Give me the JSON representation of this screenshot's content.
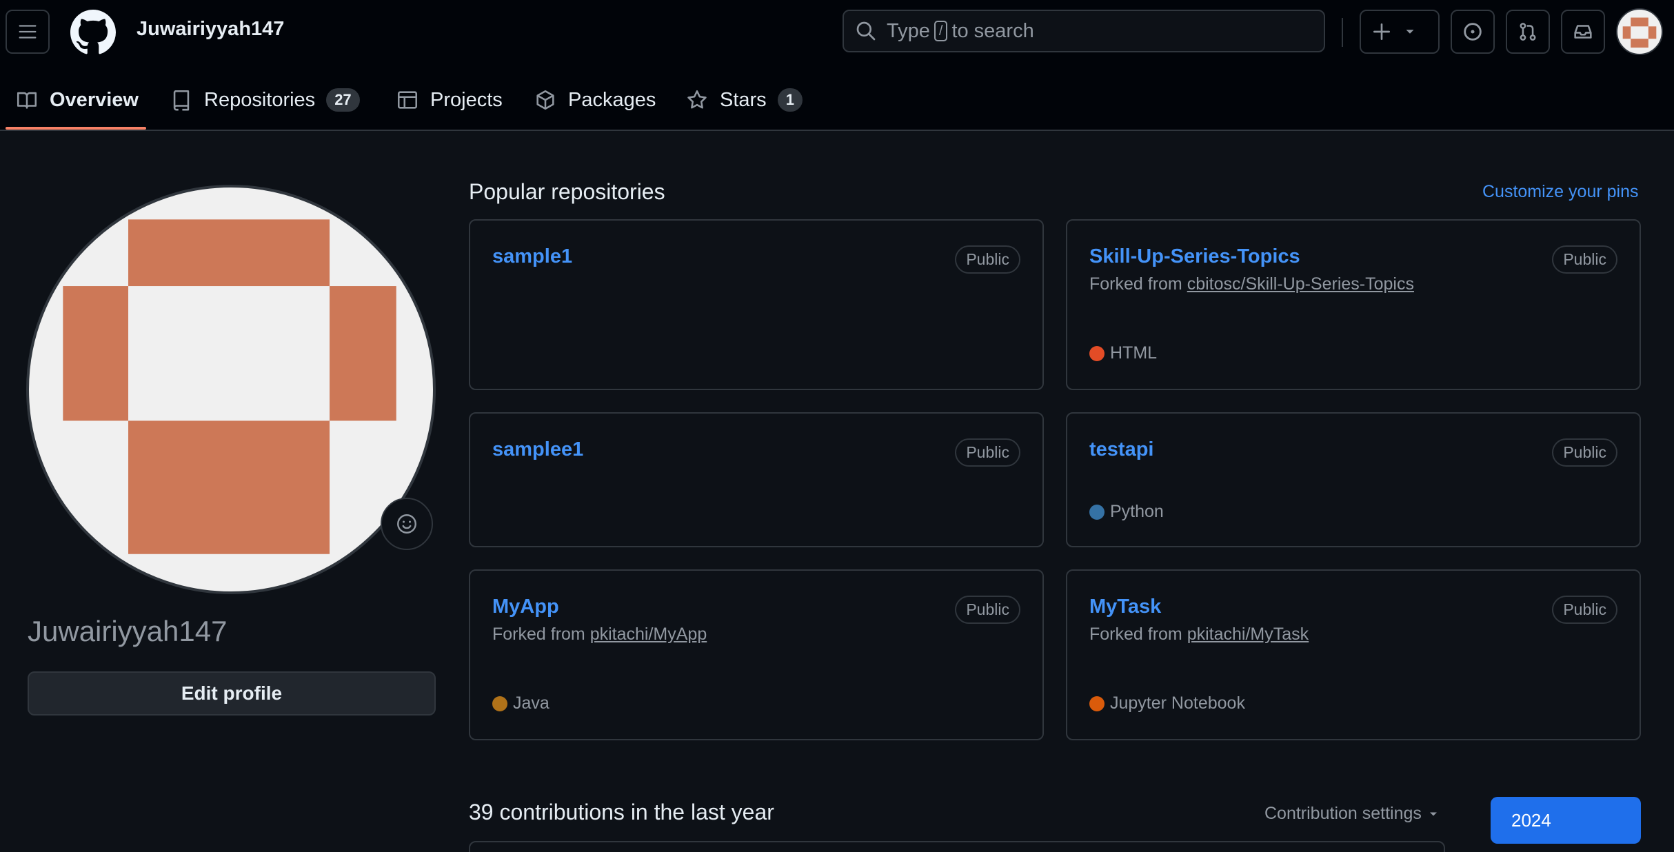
{
  "header": {
    "username": "Juwairiyyah147",
    "search_prefix": "Type",
    "search_key": "/",
    "search_suffix": "to search"
  },
  "tabs": [
    {
      "label": "Overview",
      "icon": "book-icon"
    },
    {
      "label": "Repositories",
      "icon": "repo-icon",
      "count": "27"
    },
    {
      "label": "Projects",
      "icon": "table-icon"
    },
    {
      "label": "Packages",
      "icon": "package-icon"
    },
    {
      "label": "Stars",
      "icon": "star-icon",
      "count": "1"
    }
  ],
  "profile": {
    "display_name": "Juwairiyyah147",
    "edit_label": "Edit profile"
  },
  "popular": {
    "title": "Popular repositories",
    "customize_label": "Customize your pins",
    "repos": [
      {
        "name": "sample1",
        "visibility": "Public"
      },
      {
        "name": "Skill-Up-Series-Topics",
        "visibility": "Public",
        "forked_prefix": "Forked from",
        "forked_from": "cbitosc/Skill-Up-Series-Topics",
        "language": "HTML",
        "language_color": "#e34c26"
      },
      {
        "name": "samplee1",
        "visibility": "Public"
      },
      {
        "name": "testapi",
        "visibility": "Public",
        "language": "Python",
        "language_color": "#3572A5"
      },
      {
        "name": "MyApp",
        "visibility": "Public",
        "forked_prefix": "Forked from",
        "forked_from": "pkitachi/MyApp",
        "language": "Java",
        "language_color": "#b07219"
      },
      {
        "name": "MyTask",
        "visibility": "Public",
        "forked_prefix": "Forked from",
        "forked_from": "pkitachi/MyTask",
        "language": "Jupyter Notebook",
        "language_color": "#DA5B0B"
      }
    ]
  },
  "contributions": {
    "title": "39 contributions in the last year",
    "settings_label": "Contribution settings",
    "year": "2024"
  },
  "colors": {
    "background": "#0d1117",
    "header": "#010409",
    "accent_link": "#4493f8",
    "tab_underline": "#f78166",
    "avatar_pattern": "#cd7857",
    "year_button": "#1f6feb"
  }
}
